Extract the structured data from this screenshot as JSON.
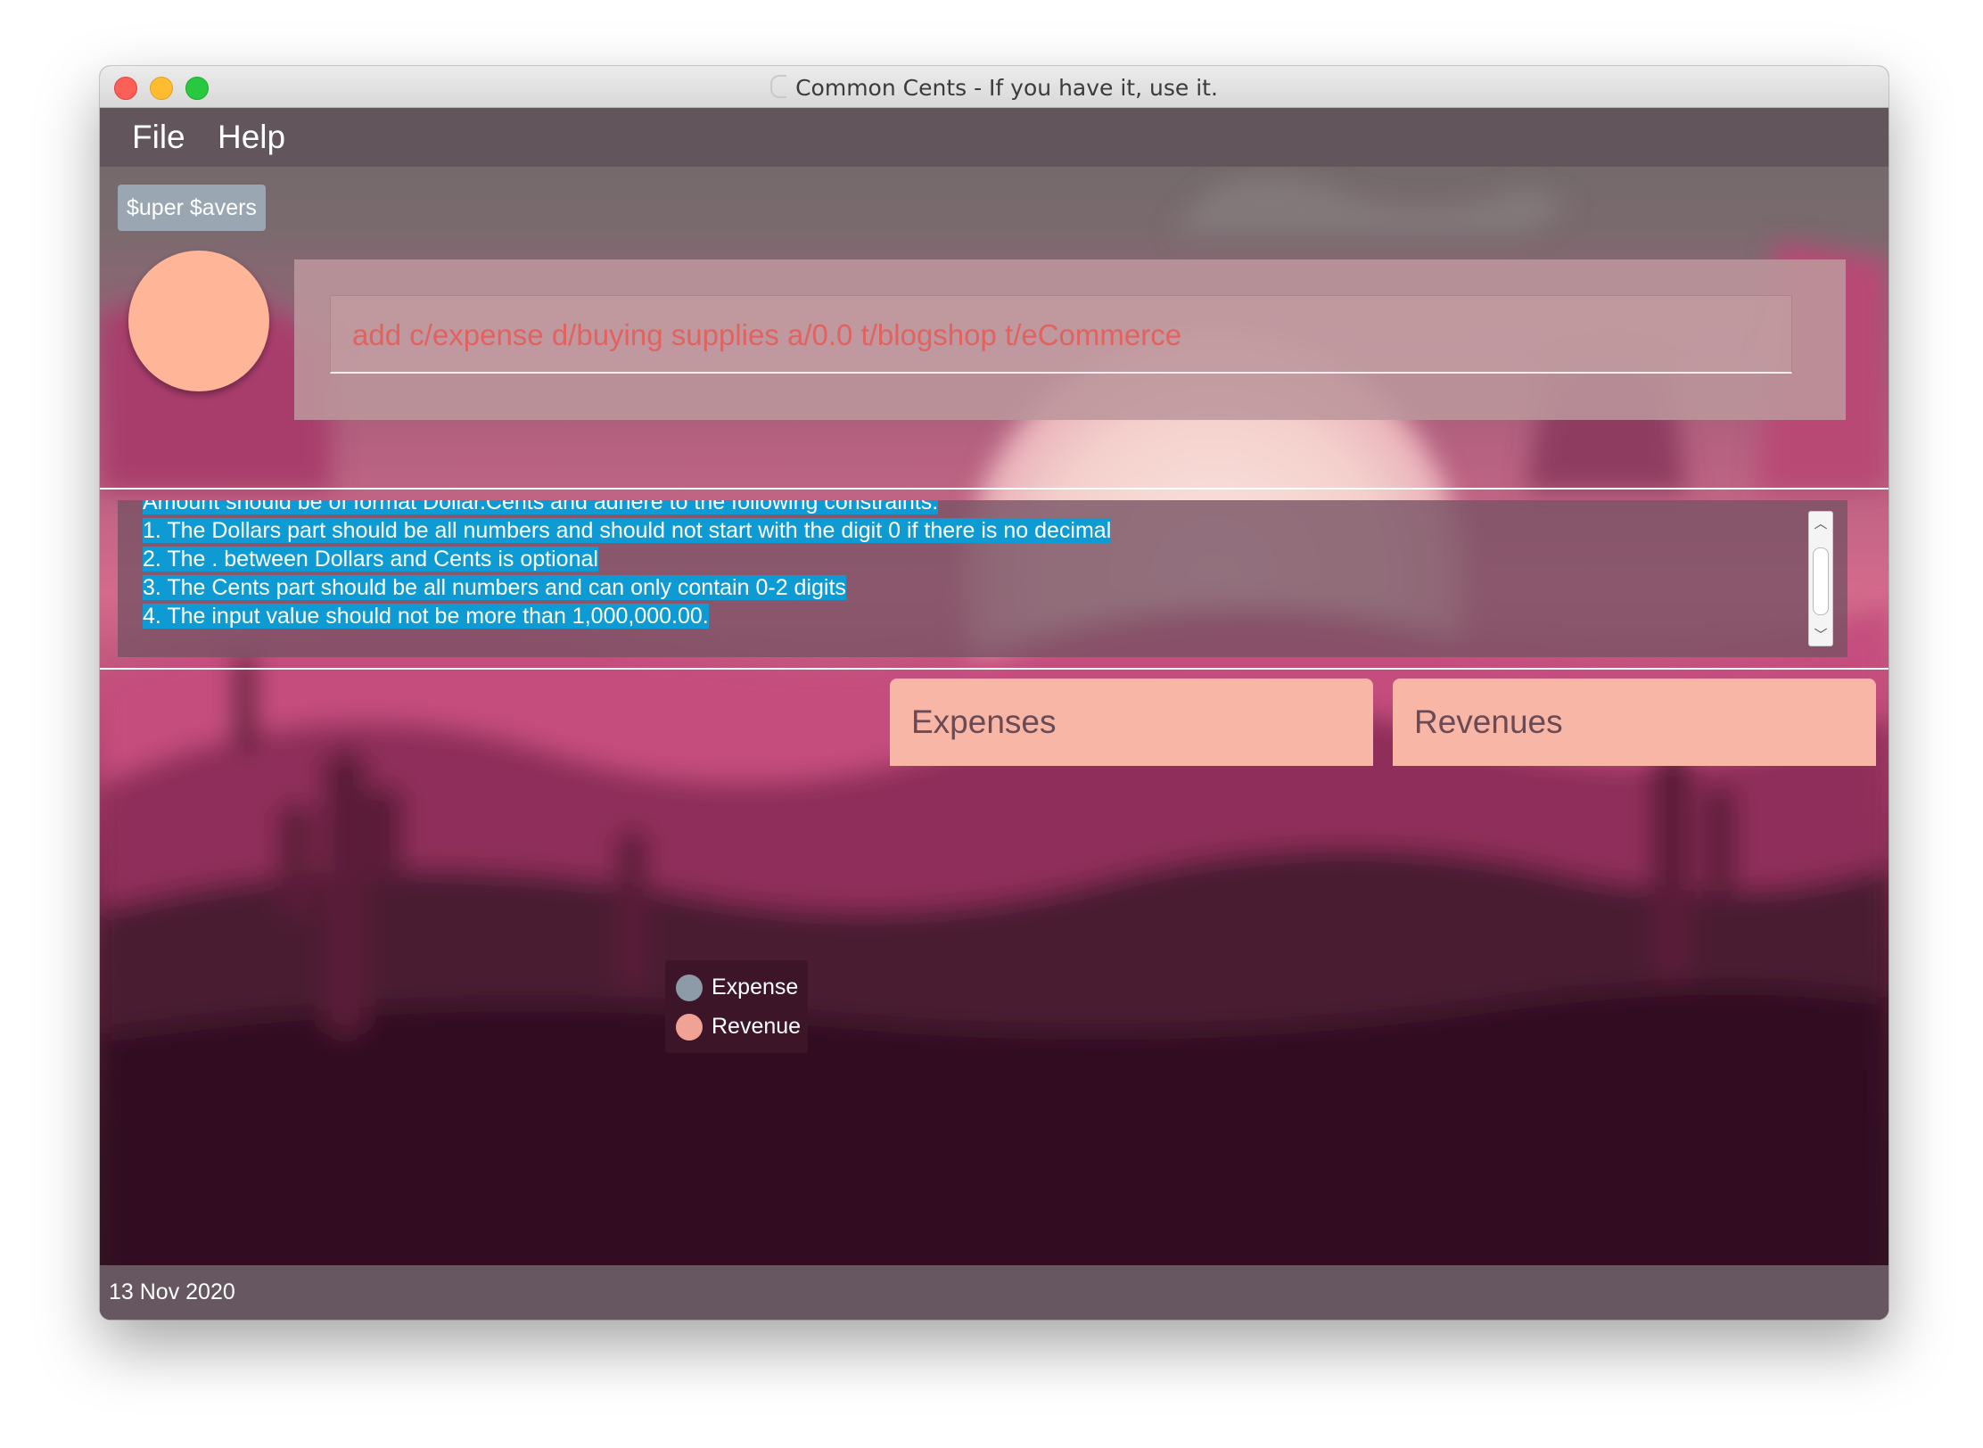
{
  "window": {
    "title": "Common Cents - If you have it, use it."
  },
  "menu": {
    "file_label": "File",
    "help_label": "Help"
  },
  "team_badge": "$uper $avers",
  "command_box": {
    "value": "add c/expense d/buying supplies a/0.0 t/blogshop t/eCommerce"
  },
  "result_display": {
    "lines": [
      "Amount should be of format Dollar.Cents and adhere to the following constraints:",
      "1. The Dollars part should be all numbers and should not start with the digit 0 if there is no decimal",
      "2. The . between Dollars and Cents is optional",
      "3. The Cents part should be all numbers and can only contain 0-2 digits",
      "4. The input value should not be more than 1,000,000.00."
    ]
  },
  "tabs": {
    "expenses_label": "Expenses",
    "revenues_label": "Revenues"
  },
  "chart_legend": {
    "items": [
      {
        "label": "Expense",
        "color": "#8d9aa7"
      },
      {
        "label": "Revenue",
        "color": "#f0a294"
      }
    ]
  },
  "status_bar": {
    "date": "13 Nov 2020"
  },
  "colors": {
    "accent_peach": "#f8b6a6",
    "avatar": "#ffb598",
    "command_text": "#e2625f",
    "selection": "#0e9bd4"
  },
  "icons": [
    "close-traffic-light",
    "minimize-traffic-light",
    "zoom-traffic-light",
    "scroll-up-arrow",
    "scroll-down-arrow"
  ]
}
